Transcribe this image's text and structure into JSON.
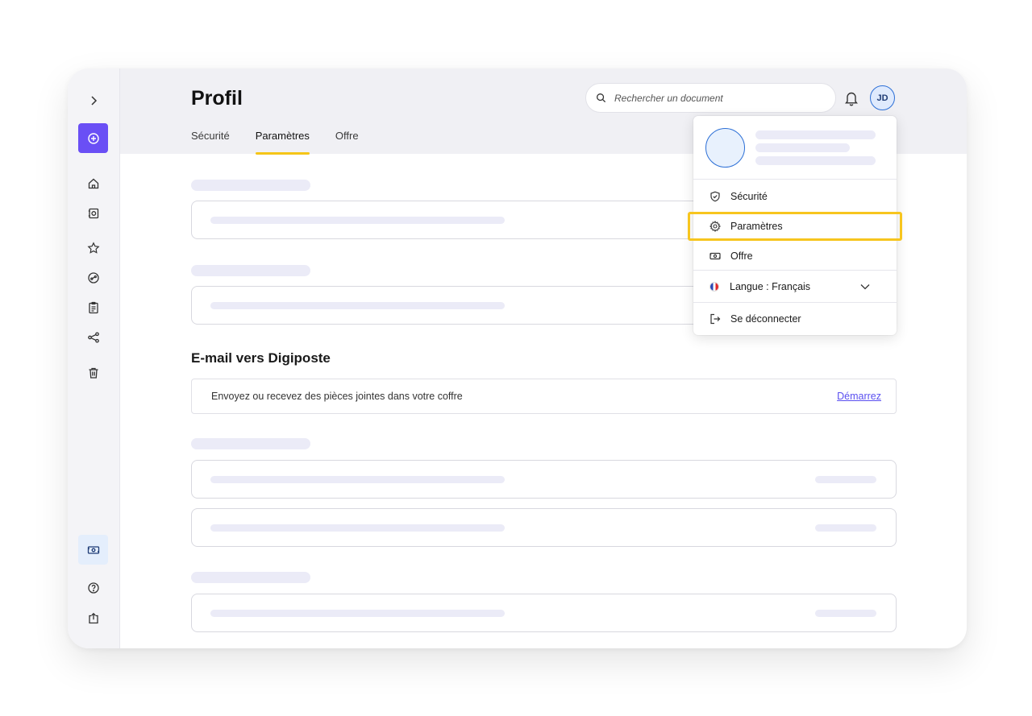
{
  "header": {
    "title": "Profil",
    "tabs": [
      {
        "label": "Sécurité"
      },
      {
        "label": "Paramètres"
      },
      {
        "label": "Offre"
      }
    ],
    "search_placeholder": "Rechercher un document",
    "avatar_initials": "JD"
  },
  "email_section": {
    "title": "E-mail vers Digiposte",
    "description": "Envoyez ou recevez des pièces jointes dans votre coffre",
    "link_label": "Démarrez"
  },
  "menu": {
    "items": [
      {
        "label": "Sécurité"
      },
      {
        "label": "Paramètres"
      },
      {
        "label": "Offre"
      },
      {
        "label": "Langue : Français"
      },
      {
        "label": "Se déconnecter"
      }
    ]
  },
  "colors": {
    "accent": "#6a4ff5",
    "highlight": "#f7c51e",
    "tab_indicator": "#f5c518",
    "link": "#5a4ff0",
    "avatar_border": "#2c6fd6"
  },
  "icons": {
    "sidebar": [
      "expand-chevron-icon",
      "add-icon",
      "home-icon",
      "documents-icon",
      "star-icon",
      "share-circle-icon",
      "clipboard-icon",
      "share-icon",
      "trash-icon",
      "offer-icon",
      "help-icon",
      "export-icon"
    ]
  }
}
